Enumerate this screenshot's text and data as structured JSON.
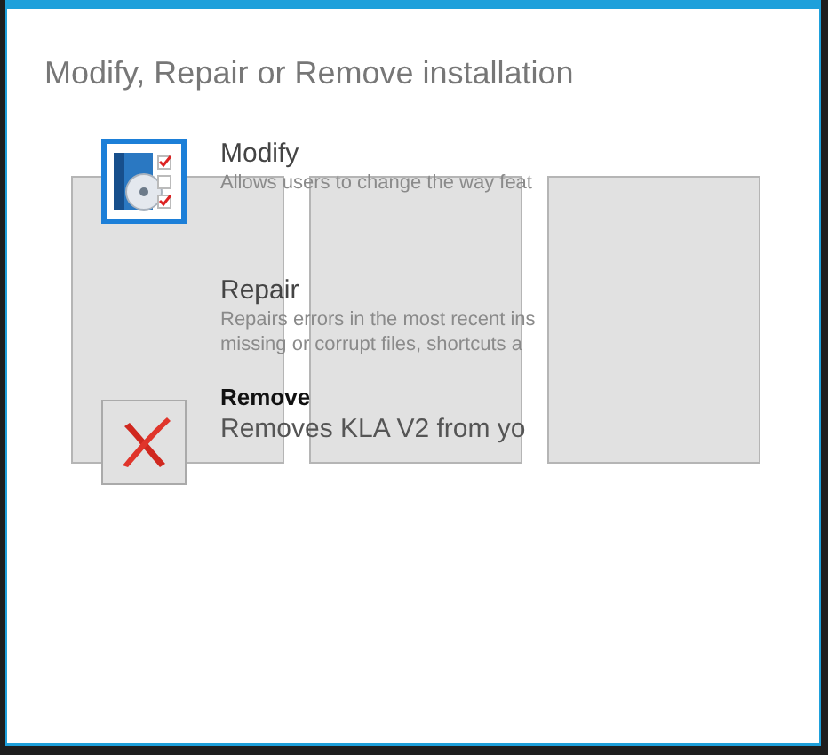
{
  "title": "Modify, Repair or Remove installation",
  "options": [
    {
      "kind": "modify",
      "label": "Modify",
      "description": [
        "Allows users to change the way feat"
      ],
      "selected": true,
      "emphasized": false
    },
    {
      "kind": "repair",
      "label": "Repair",
      "description": [
        "Repairs errors in the most recent ins",
        "missing or corrupt files, shortcuts a"
      ]
    },
    {
      "kind": "remove",
      "label": "Remove",
      "description": [
        "Removes KLA V2 from yo"
      ],
      "selected": false,
      "emphasized": true
    }
  ],
  "panels": [
    {
      "kind": "panel"
    },
    {
      "kind": "panel"
    },
    {
      "kind": "panel"
    }
  ]
}
